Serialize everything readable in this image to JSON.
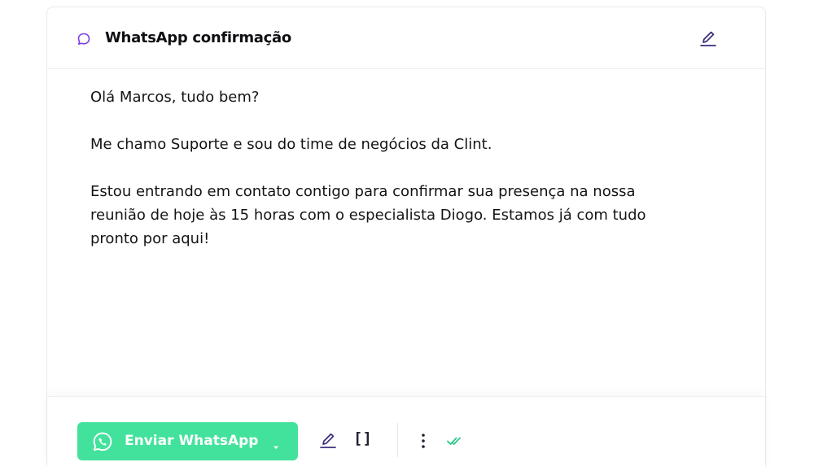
{
  "card": {
    "title": "WhatsApp confirmação",
    "title_icon": "chat-bubble-icon",
    "edit_icon": "pencil-icon"
  },
  "message": {
    "paragraphs": [
      "Olá Marcos, tudo bem?",
      "Me chamo Suporte e sou do time de negócios da Clint.",
      "Estou entrando em contato contigo para confirmar sua presença na nossa reunião de hoje às 15 horas com o especialista Diogo. Estamos já com tudo pronto por aqui!"
    ]
  },
  "footer": {
    "send_button_label": "Enviar WhatsApp",
    "send_button_icon": "whatsapp-icon",
    "dropdown_icon": "caret-down-icon",
    "edit_icon": "pencil-icon",
    "variables_label": "[]",
    "more_icon": "vertical-dots-icon",
    "status_icon": "double-check-icon"
  },
  "colors": {
    "accent": "#43e29c",
    "chat_icon": "#7b3fe4",
    "pencil_icon": "#3b2a7a",
    "double_check": "#2cc98a"
  }
}
